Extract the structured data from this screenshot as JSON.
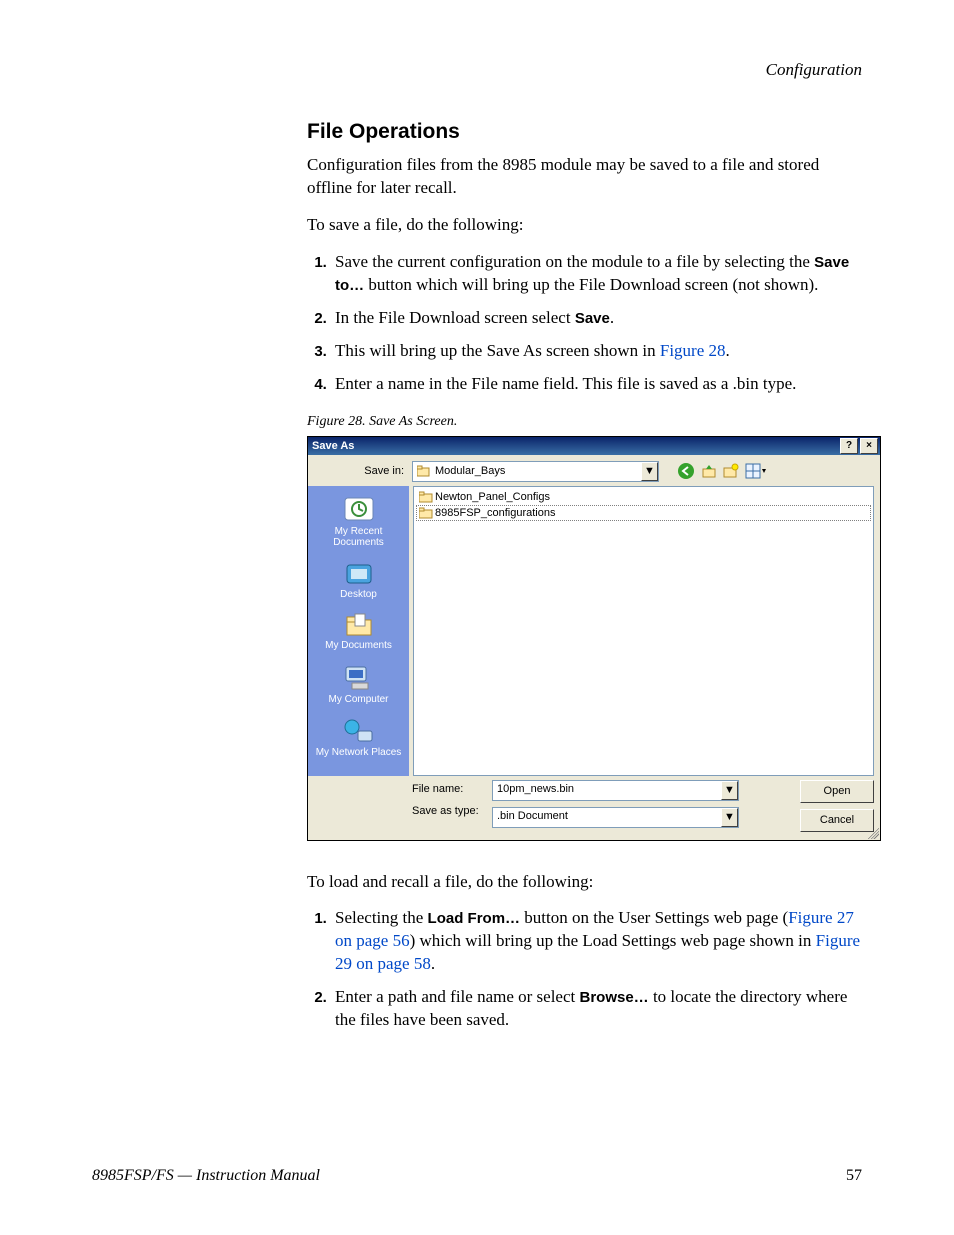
{
  "running_head": "Configuration",
  "heading": "File Operations",
  "intro": "Configuration files from the 8985 module may be saved to a file and stored offline for later recall.",
  "save_lead": "To save a file, do the following:",
  "step1_a": "Save the current configuration on the module to a file by selecting the ",
  "step1_bold": "Save to…",
  "step1_b": " button which will bring up the File Download screen (not shown).",
  "step2_a": "In the File Download screen select ",
  "step2_bold": "Save",
  "step2_b": ".",
  "step3_a": "This will bring up the Save As screen shown in ",
  "step3_link": "Figure 28",
  "step3_b": ".",
  "step4": "Enter a name in the File name field. This file is saved as a .bin type.",
  "fig_caption": "Figure 28.  Save As Screen.",
  "dlg": {
    "title": "Save As",
    "help_glyph": "?",
    "close_glyph": "×",
    "save_in_label": "Save in:",
    "save_in_value": "Modular_Bays",
    "items": [
      "Newton_Panel_Configs",
      "8985FSP_configurations"
    ],
    "places": [
      "My Recent Documents",
      "Desktop",
      "My Documents",
      "My Computer",
      "My Network Places"
    ],
    "file_name_label": "File name:",
    "file_name_value": "10pm_news.bin",
    "save_type_label": "Save as type:",
    "save_type_value": ".bin Document",
    "open_btn": "Open",
    "cancel_btn": "Cancel"
  },
  "load_lead": "To load and recall a file, do the following:",
  "load1_a": "Selecting the ",
  "load1_bold": "Load From…",
  "load1_b": " button on the User Settings web page (",
  "load1_link1": "Figure 27 on page 56",
  "load1_c": ") which will bring up the Load Settings web page shown in ",
  "load1_link2": "Figure 29 on page 58",
  "load1_d": ".",
  "load2_a": "Enter a path and file name or select ",
  "load2_bold": "Browse…",
  "load2_b": " to locate the directory where the files have been saved.",
  "footer_left": "8985FSP/FS — Instruction Manual",
  "footer_right": "57"
}
